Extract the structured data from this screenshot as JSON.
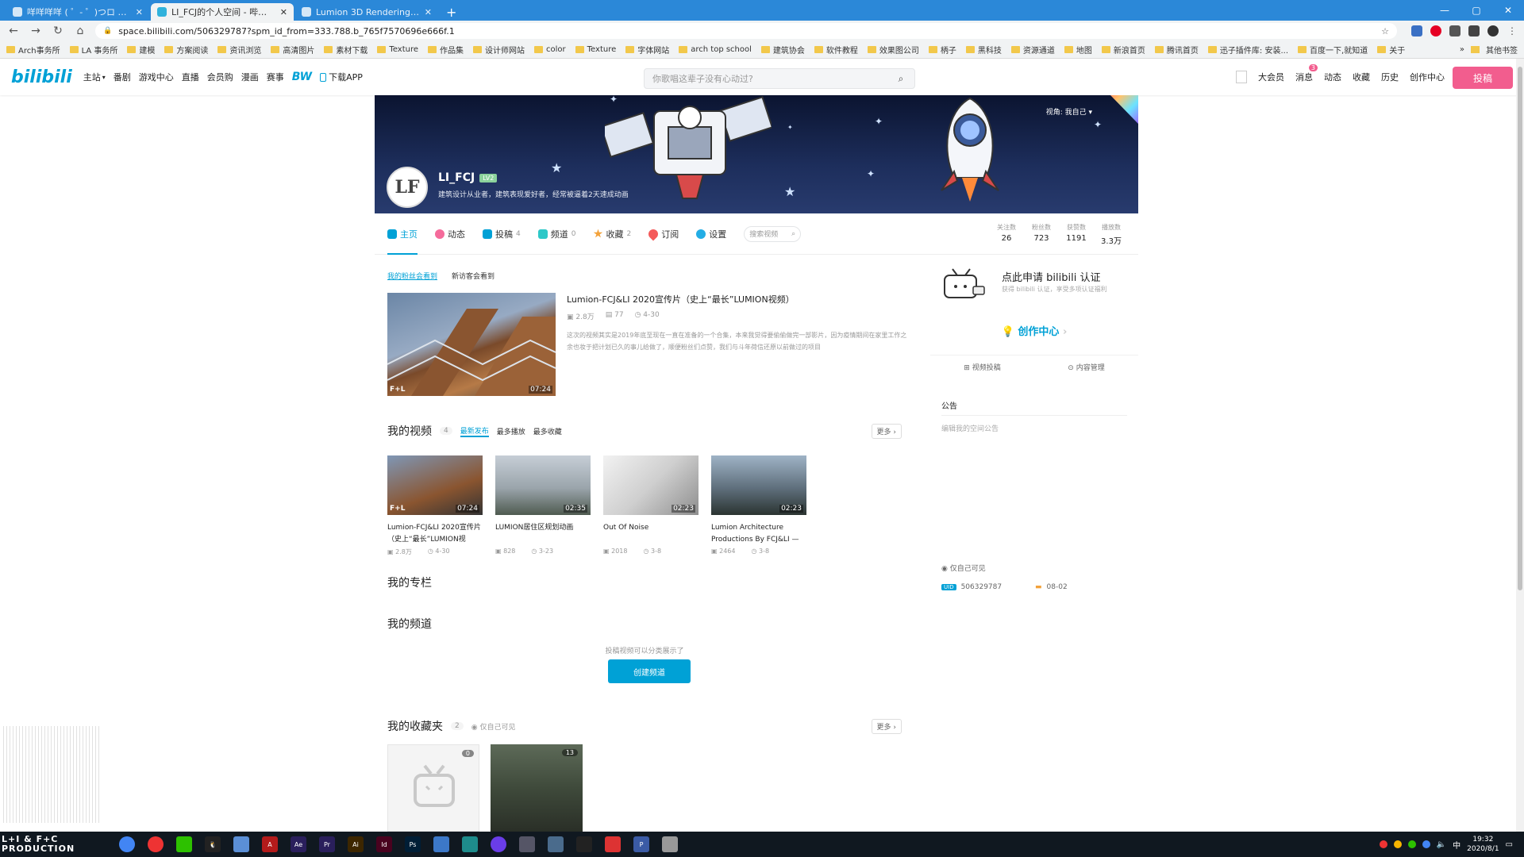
{
  "browser": {
    "tabs": [
      {
        "title": "咩咩咩咩 ( ゜- ゜)つロ 干杯~-bili"
      },
      {
        "title": "LI_FCJ的个人空间 - 哔哩哔哩 ( "
      },
      {
        "title": "Lumion 3D Rendering Softwa"
      }
    ],
    "url": "space.bilibili.com/506329787?spm_id_from=333.788.b_765f7570696e666f.1",
    "bookmarks": [
      "Arch事务所",
      "LA 事务所",
      "建模",
      "方案阅读",
      "资讯浏览",
      "高清图片",
      "素材下载",
      "Texture",
      "作品集",
      "设计师网站",
      "color",
      "Texture",
      "字体网站",
      "arch top school",
      "建筑协会",
      "软件教程",
      "效果图公司",
      "柄子",
      "黑科技",
      "资源通道",
      "地图",
      "新浪首页",
      "腾讯首页",
      "迅子插件库: 安装...",
      "百度一下,就知道",
      "关于"
    ],
    "bookmarks_more": "其他书签"
  },
  "header": {
    "logo": "bilibili",
    "nav": [
      "主站",
      "番剧",
      "游戏中心",
      "直播",
      "会员购",
      "漫画",
      "赛事"
    ],
    "nav_bw": "BW",
    "download_app": "下载APP",
    "search_placeholder": "你歌唱这辈子没有心动过?",
    "right": [
      "大会员",
      "消息",
      "动态",
      "收藏",
      "历史",
      "创作中心"
    ],
    "msg_badge": "3",
    "post_button": "投稿"
  },
  "profile": {
    "avatar_text": "LF",
    "name": "LI_FCJ",
    "level": "LV2",
    "sign": "建筑设计从业者，建筑表现爱好者，经常被逼着2天速成动画",
    "view_as": "视角: 我自己",
    "tabs": [
      {
        "label": "主页",
        "count": ""
      },
      {
        "label": "动态",
        "count": ""
      },
      {
        "label": "投稿",
        "count": "4"
      },
      {
        "label": "频道",
        "count": "0"
      },
      {
        "label": "收藏",
        "count": "2"
      },
      {
        "label": "订阅",
        "count": ""
      },
      {
        "label": "设置",
        "count": ""
      }
    ],
    "tab_search_placeholder": "搜索视频",
    "stats": [
      {
        "label": "关注数",
        "value": "26"
      },
      {
        "label": "粉丝数",
        "value": "723"
      },
      {
        "label": "获赞数",
        "value": "1191"
      },
      {
        "label": "播放数",
        "value": "3.3万"
      }
    ]
  },
  "featured": {
    "subtabs": [
      "我的粉丝会看到",
      "新访客会看到"
    ],
    "title": "Lumion-FCJ&LI 2020宣传片（史上“最长”LUMION视频）",
    "plays": "2.8万",
    "danmaku": "77",
    "date": "4-30",
    "duration": "07:24",
    "desc": "这次的视频其实是2019年底至现在一直在准备的一个合集，本来我觉得要偷偷做完一部影片，因为疫情期间在家里工作之余也妆于把计划已久的事儿给做了，顺便粉丝们点赞，我们与斗年荷信还原以前做过的项目",
    "brand_mark": "F+L"
  },
  "videos": {
    "title": "我的视频",
    "count": "4",
    "sorts": [
      "最新发布",
      "最多播放",
      "最多收藏"
    ],
    "more": "更多",
    "items": [
      {
        "title": "Lumion-FCJ&LI 2020宣传片（史上“最长”LUMION视",
        "plays": "2.8万",
        "date": "4-30",
        "duration": "07:24"
      },
      {
        "title": "LUMION居住区规划动画",
        "plays": "828",
        "date": "3-23",
        "duration": "02:35"
      },
      {
        "title": "Out Of Noise",
        "plays": "2018",
        "date": "3-8",
        "duration": "02:23"
      },
      {
        "title": "Lumion Architecture Productions By FCJ&LI —",
        "plays": "2464",
        "date": "3-8",
        "duration": "02:23"
      }
    ]
  },
  "column": {
    "title": "我的专栏"
  },
  "channel": {
    "title": "我的频道",
    "hint": "投稿视频可以分类展示了",
    "button": "创建频道"
  },
  "favorites": {
    "title": "我的收藏夹",
    "count": "2",
    "visibility": "仅自己可见",
    "more": "更多",
    "items": [
      {
        "count": "0"
      },
      {
        "count": "13"
      }
    ]
  },
  "side": {
    "auth_title": "点此申请 bilibili 认证",
    "auth_sub": "获得 bilibili 认证，享受多项认证福利",
    "creator_title": "创作中心",
    "creator_links": [
      "视频投稿",
      "内容管理"
    ],
    "notice_title": "公告",
    "notice_placeholder": "编辑我的空间公告",
    "visibility": "仅自己可见",
    "uid": "506329787",
    "birthday": "08-02"
  },
  "taskbar": {
    "brand": "L+I & F+C PRODUCTION",
    "time": "19:32",
    "date": "2020/8/1",
    "ime": "中"
  },
  "colors": {
    "brand": "#00a1d6",
    "pink": "#f25d8e"
  }
}
